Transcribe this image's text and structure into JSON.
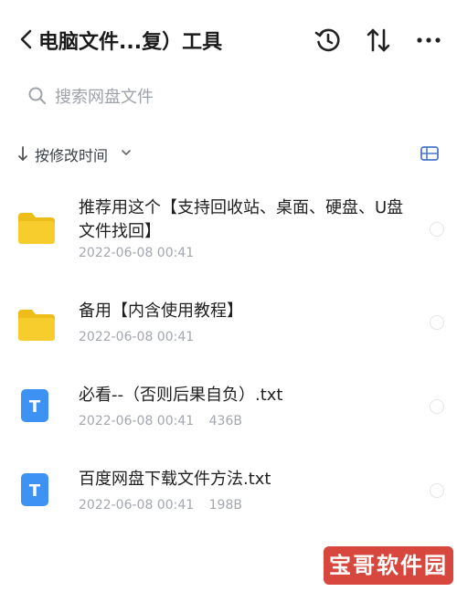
{
  "header": {
    "title": "电脑文件...复）工具",
    "icons": [
      "chevron-left-icon",
      "history-icon",
      "sort-icon",
      "more-icon"
    ]
  },
  "search": {
    "placeholder": "搜索网盘文件"
  },
  "sort": {
    "label": "按修改时间"
  },
  "files": [
    {
      "name": "推荐用这个【支持回收站、桌面、硬盘、U盘文件找回】",
      "date": "2022-06-08 00:41",
      "size": "",
      "type": "folder"
    },
    {
      "name": "备用【内含使用教程】",
      "date": "2022-06-08 00:41",
      "size": "",
      "type": "folder"
    },
    {
      "name": "必看--（否则后果自负）.txt",
      "date": "2022-06-08 00:41",
      "size": "436B",
      "type": "txt"
    },
    {
      "name": "百度网盘下载文件方法.txt",
      "date": "2022-06-08 00:41",
      "size": "198B",
      "type": "txt"
    }
  ],
  "txt_icon_letter": "T",
  "watermark": {
    "text": "宝哥软件园"
  },
  "colors": {
    "folder": "#f7cd2e",
    "folder_tab": "#efbd1a",
    "txt_icon": "#3e92f4",
    "watermark": "#d7473d"
  }
}
